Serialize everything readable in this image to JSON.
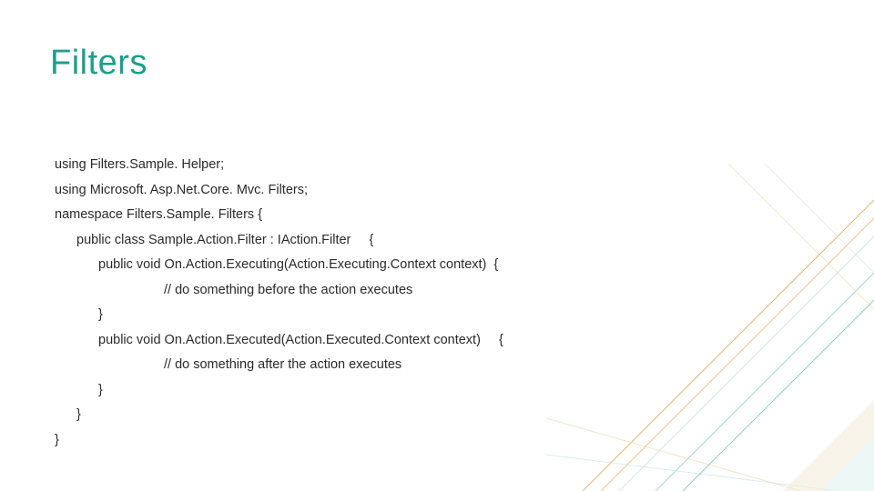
{
  "title": "Filters",
  "code": {
    "l1": "using Filters.Sample. Helper;",
    "l2": "using Microsoft. Asp.Net.Core. Mvc. Filters;",
    "l3": "namespace Filters.Sample. Filters {",
    "l4": "public class Sample.Action.Filter : IAction.Filter     {",
    "l5": "public void On.Action.Executing(Action.Executing.Context context)  {",
    "l6": "// do something before the action executes",
    "l7": "}",
    "l8": "public void On.Action.Executed(Action.Executed.Context context)     {",
    "l9": "// do something after the action executes",
    "l10": "}",
    "l11": "}",
    "l12": "}"
  }
}
